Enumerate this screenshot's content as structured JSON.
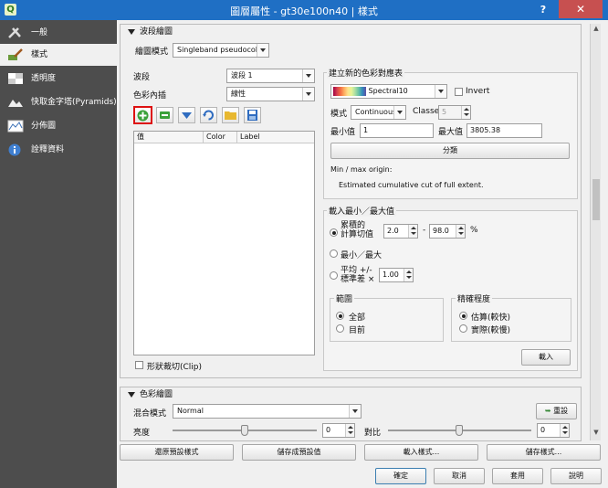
{
  "window": {
    "title": "圖層屬性 - gt30e100n40 | 樣式",
    "help": "?",
    "close": "✕"
  },
  "sidebar": {
    "items": [
      {
        "label": "一般",
        "icon": "tools-icon"
      },
      {
        "label": "樣式",
        "icon": "style-brush-icon"
      },
      {
        "label": "透明度",
        "icon": "transparency-icon"
      },
      {
        "label": "快取金字塔(Pyramids)",
        "icon": "pyramid-icon"
      },
      {
        "label": "分佈圖",
        "icon": "histogram-icon"
      },
      {
        "label": "詮釋資料",
        "icon": "info-icon"
      }
    ]
  },
  "band_render": {
    "title": "波段繪圖",
    "render_type_label": "繪圖模式",
    "render_type_value": "Singleband pseudocolor",
    "band_label": "波段",
    "band_value": "波段 1",
    "interp_label": "色彩內插",
    "interp_value": "線性",
    "table_headers": [
      "值",
      "Color",
      "Label"
    ],
    "clip_label": "形狀裁切(Clip)",
    "new_ramp": {
      "title": "建立新的色彩對應表",
      "ramp_value": "Spectral10",
      "invert_label": "Invert",
      "mode_label": "模式",
      "mode_value": "Continuous",
      "classes_label": "Classes",
      "classes_value": "5",
      "min_label": "最小值",
      "min_value": "1",
      "max_label": "最大值",
      "max_value": "3805.38",
      "classify_button": "分類",
      "origin_label": "Min / max origin:",
      "origin_value": "Estimated cumulative cut of full extent."
    },
    "load_minmax": {
      "title": "載入最小／最大值",
      "cumcut_label": "累積的\n計算切值",
      "cumcut_low": "2.0",
      "cumcut_sep": "-",
      "cumcut_high": "98.0",
      "cumcut_unit": "%",
      "minmax_label": "最小／最大",
      "meanstd_label": "平均 +/-\n標準差 ×",
      "meanstd_value": "1.00",
      "extent_title": "範圍",
      "extent_full": "全部",
      "extent_current": "目前",
      "accuracy_title": "精確程度",
      "accuracy_estimate": "估算(較快)",
      "accuracy_actual": "實際(較慢)",
      "load_button": "載入"
    }
  },
  "color_render": {
    "title": "色彩繪圖",
    "blend_label": "混合模式",
    "blend_value": "Normal",
    "reset_button": "重設",
    "brightness_label": "亮度",
    "brightness_value": "0",
    "contrast_label": "對比",
    "contrast_value": "0"
  },
  "style_buttons": [
    "還原預設樣式",
    "儲存成預設值",
    "載入樣式...",
    "儲存樣式..."
  ],
  "dialog_buttons": [
    "確定",
    "取消",
    "套用",
    "說明"
  ]
}
